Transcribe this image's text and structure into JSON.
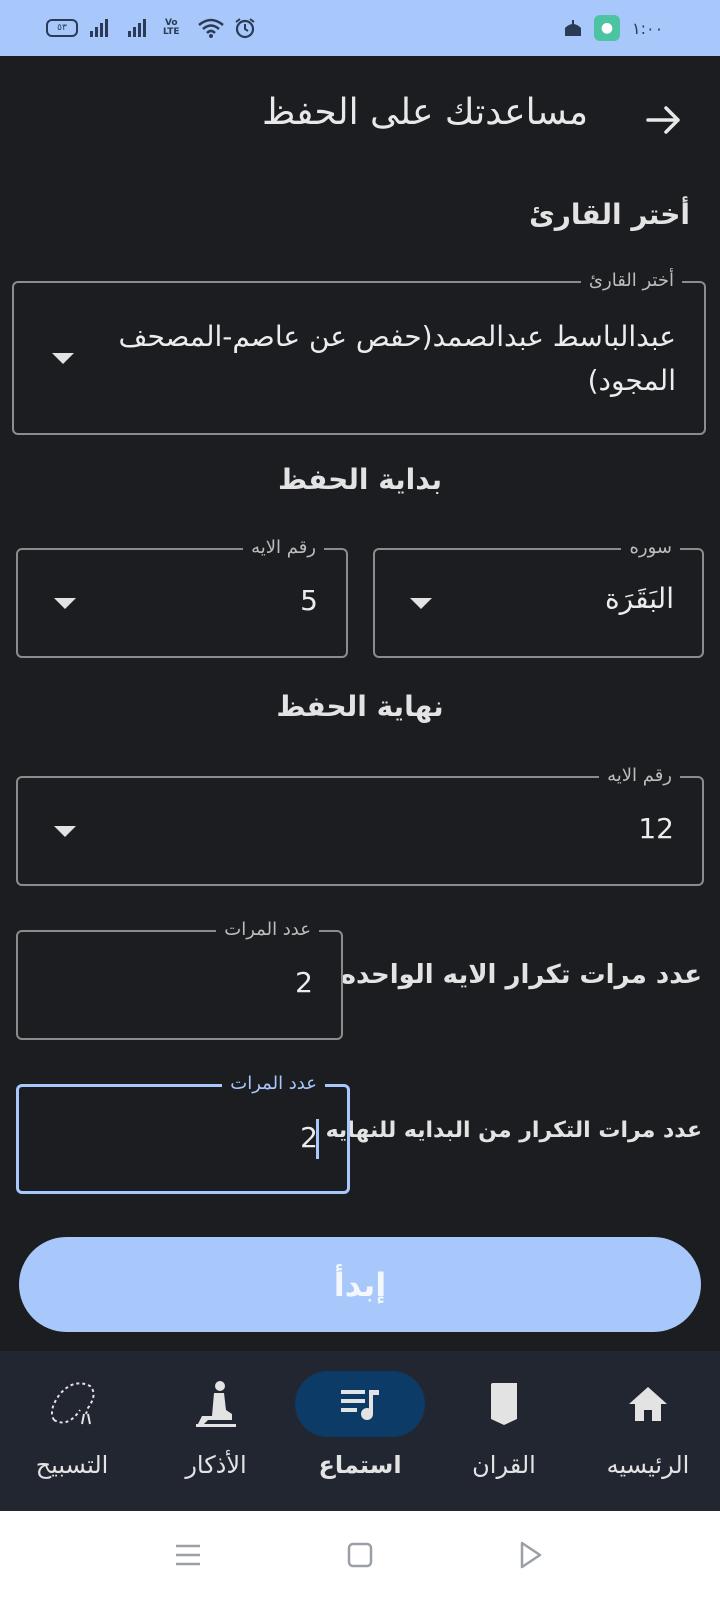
{
  "status_bar": {
    "battery": "٥٣",
    "volte": [
      "Vo",
      "LTE"
    ],
    "time": "١:٠٠",
    "icons": [
      "battery-icon",
      "signal-icon",
      "signal-icon",
      "volte-icon",
      "wifi-icon",
      "alarm-icon",
      "notification-icon",
      "app-icon"
    ]
  },
  "header": {
    "title": "مساعدتك على الحفظ",
    "back_icon": "arrow-right-icon"
  },
  "reciter": {
    "section_label": "أختر القارئ",
    "field_label": "أختر القارئ",
    "value_line1": "عبدالباسط عبدالصمد(حفص عن عاصم-المصحف",
    "value_line2": "المجود)"
  },
  "start": {
    "section_label": "بداية الحفظ",
    "surah_label": "سوره",
    "surah_value": "البَقَرَة",
    "ayah_label": "رقم الايه",
    "ayah_value": "5"
  },
  "end": {
    "section_label": "نهاية الحفظ",
    "ayah_label": "رقم الايه",
    "ayah_value": "12"
  },
  "repeat_ayah": {
    "label": "عدد مرات تكرار الايه الواحده",
    "field_label": "عدد المرات",
    "value": "2"
  },
  "repeat_range": {
    "label": "عدد مرات التكرار من البدايه للنهايه",
    "field_label": "عدد المرات",
    "value": "2"
  },
  "start_button": {
    "label": "إبدأ"
  },
  "bottom_nav": {
    "items": [
      {
        "label": "الرئيسيه",
        "icon": "home-icon"
      },
      {
        "label": "القران",
        "icon": "book-icon"
      },
      {
        "label": "استماع",
        "icon": "playlist-icon",
        "active": true
      },
      {
        "label": "الأذكار",
        "icon": "prayer-icon"
      },
      {
        "label": "التسبيح",
        "icon": "tasbih-icon"
      }
    ]
  },
  "system_nav": {
    "icons": [
      "menu-icon",
      "home-square-icon",
      "back-triangle-icon"
    ]
  },
  "colors": {
    "accent": "#a8c8fb",
    "background": "#1c1d20",
    "nav_background": "#222631",
    "active_pill": "#0b3b66"
  }
}
